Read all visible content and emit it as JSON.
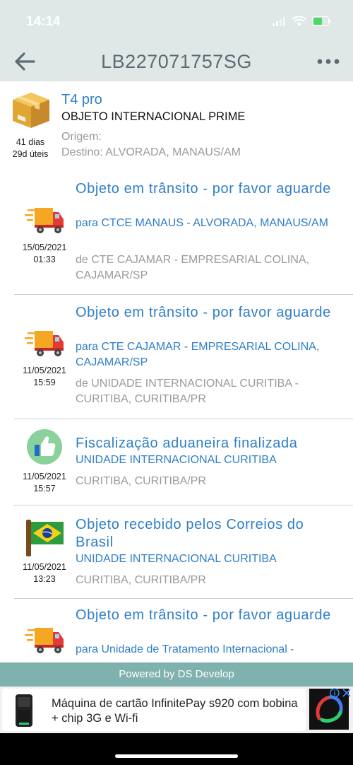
{
  "status_bar": {
    "time": "14:14",
    "icons": [
      "signal-icon",
      "wifi-icon",
      "battery-icon"
    ]
  },
  "header": {
    "title": "LB227071757SG",
    "back_icon": "back-arrow-icon",
    "menu_icon": "more-icon"
  },
  "package": {
    "name": "T4 pro",
    "type": "OBJETO INTERNACIONAL PRIME",
    "days": "41 dias",
    "business_days": "29d úteis",
    "origin": "Origem:",
    "destination": "Destino: ALVORADA, MANAUS/AM",
    "icon": "package-icon"
  },
  "events": [
    {
      "icon": "truck-icon",
      "date": "15/05/2021",
      "time": "01:33",
      "status": "Objeto em trânsito - por favor aguarde",
      "to": "para CTCE MANAUS - ALVORADA, MANAUS/AM",
      "from": "de CTE CAJAMAR - EMPRESARIAL COLINA, CAJAMAR/SP"
    },
    {
      "icon": "truck-icon",
      "date": "11/05/2021",
      "time": "15:59",
      "status": "Objeto em trânsito - por favor aguarde",
      "to": "para CTE CAJAMAR - EMPRESARIAL COLINA, CAJAMAR/SP",
      "from": "de UNIDADE INTERNACIONAL CURITIBA - CURITIBA, CURITIBA/PR"
    },
    {
      "icon": "thumbs-up-icon",
      "date": "11/05/2021",
      "time": "15:57",
      "status": "Fiscalização aduaneira finalizada",
      "to": "UNIDADE INTERNACIONAL CURITIBA",
      "from": "CURITIBA, CURITIBA/PR"
    },
    {
      "icon": "brazil-flag-icon",
      "date": "11/05/2021",
      "time": "13:23",
      "status": "Objeto recebido pelos Correios do Brasil",
      "to": "UNIDADE INTERNACIONAL CURITIBA",
      "from": "CURITIBA, CURITIBA/PR"
    },
    {
      "icon": "truck-icon",
      "date": "",
      "time": "",
      "status": "Objeto em trânsito - por favor aguarde",
      "to": "para Unidade de Tratamento Internacional -",
      "from": ""
    }
  ],
  "footer": {
    "powered_by": "Powered by DS Develop"
  },
  "ad": {
    "text": "Máquina de cartão InfinitePay s920 com bobina + chip 3G e Wi-fi",
    "info_icon": "info-icon",
    "close_icon": "close-icon"
  },
  "colors": {
    "accent": "#2f7fc6",
    "header_bg": "#dfe7e7",
    "footer_bg": "#7fb2ae",
    "muted": "#9a9a9a"
  }
}
